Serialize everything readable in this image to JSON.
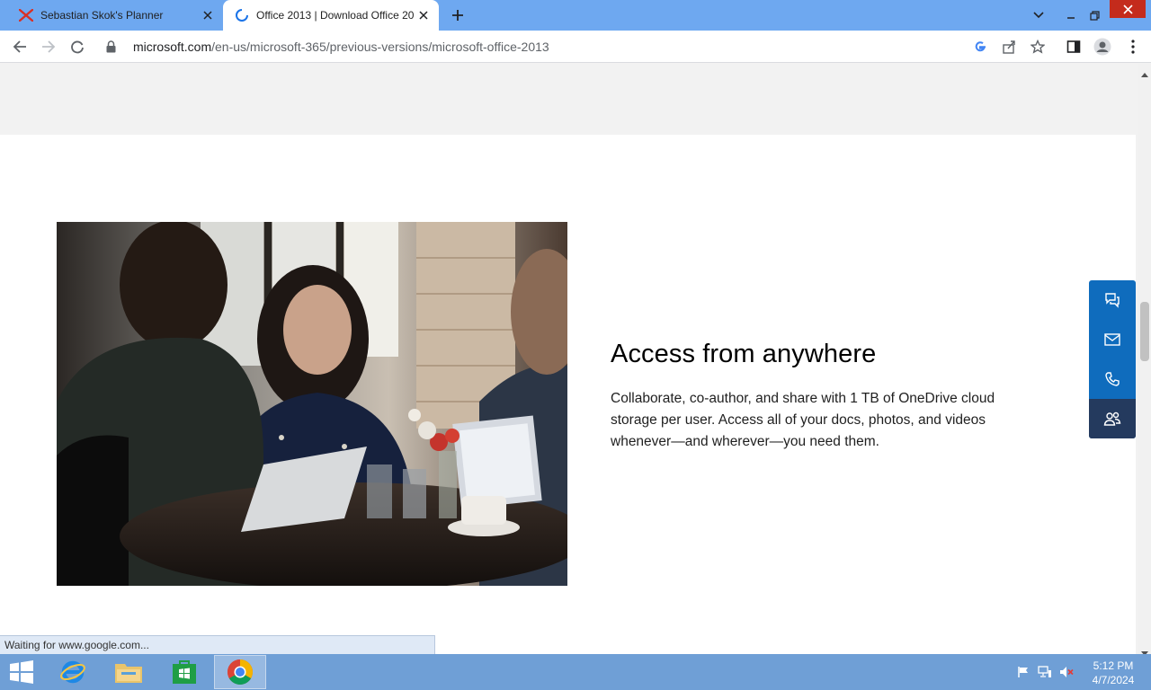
{
  "browser": {
    "tabs": [
      {
        "title": "Sebastian Skok's Planner",
        "favicon": "planner-x-icon",
        "active": false
      },
      {
        "title": "Office 2013 | Download Office 20",
        "favicon": "loading-spinner-icon",
        "active": true
      }
    ],
    "url": {
      "host": "microsoft.com",
      "path": "/en-us/microsoft-365/previous-versions/microsoft-office-2013"
    },
    "status_text": "Waiting for www.google.com..."
  },
  "page": {
    "heading": "Access from anywhere",
    "body": "Collaborate, co-author, and share with 1 TB of OneDrive cloud storage per user. Access all of your docs, photos, and videos whenever—and wherever—you need them.",
    "image_description_icon": "photo-people-at-cafe-table",
    "contact_bar": [
      "chat-icon",
      "mail-icon",
      "phone-icon",
      "people-icon"
    ]
  },
  "taskbar": {
    "apps": [
      "internet-explorer-icon",
      "file-explorer-icon",
      "store-icon",
      "chrome-icon"
    ],
    "clock": {
      "time": "5:12 PM",
      "date": "4/7/2024"
    }
  },
  "colors": {
    "tabstrip": "#6ea8f0",
    "contact_blue": "#0f6cbd",
    "contact_dark": "#243a5e",
    "taskbar": "#6f9fd6"
  }
}
